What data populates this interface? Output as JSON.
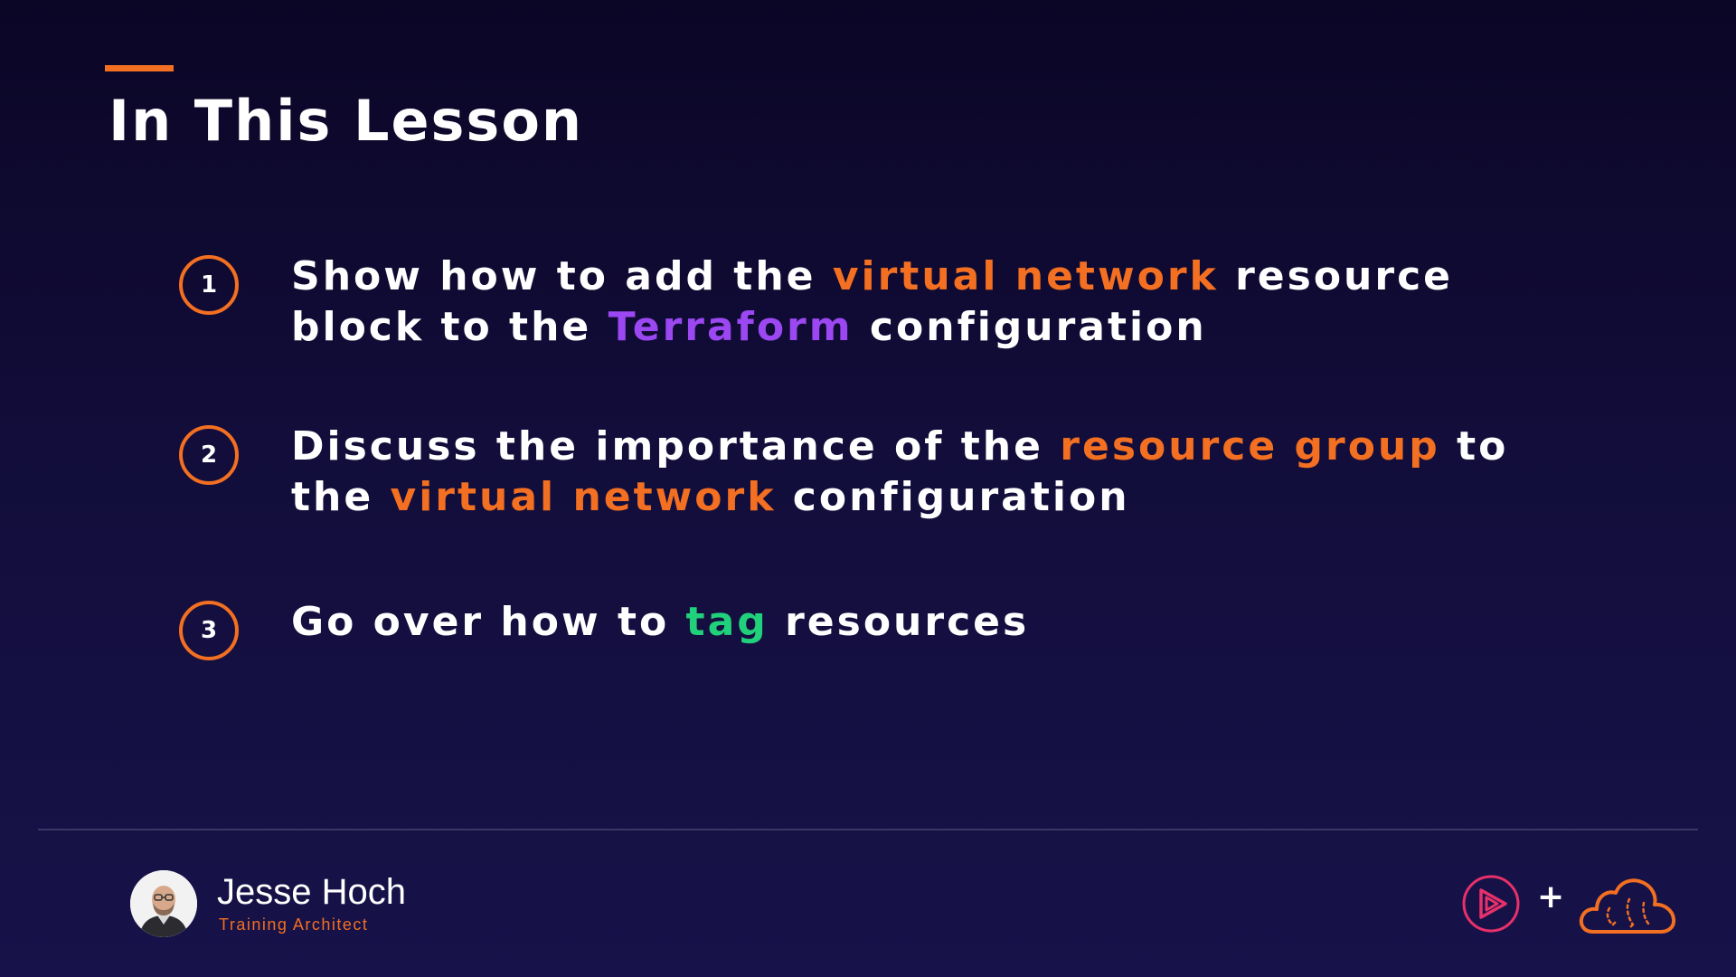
{
  "slide": {
    "title": "In This Lesson",
    "items": [
      {
        "number": "1",
        "segments": [
          {
            "text": "Show how to add the ",
            "style": "plain"
          },
          {
            "text": "virtual network",
            "style": "orange"
          },
          {
            "text": " resource block to the ",
            "style": "plain"
          },
          {
            "text": "Terraform",
            "style": "purple"
          },
          {
            "text": " configuration",
            "style": "plain"
          }
        ]
      },
      {
        "number": "2",
        "segments": [
          {
            "text": "Discuss the importance of the ",
            "style": "plain"
          },
          {
            "text": "resource group",
            "style": "orange"
          },
          {
            "text": " to the ",
            "style": "plain"
          },
          {
            "text": "virtual network",
            "style": "orange"
          },
          {
            "text": " configuration",
            "style": "plain"
          }
        ]
      },
      {
        "number": "3",
        "segments": [
          {
            "text": "Go over how to ",
            "style": "plain"
          },
          {
            "text": "tag",
            "style": "green"
          },
          {
            "text": " resources",
            "style": "plain"
          }
        ]
      }
    ]
  },
  "presenter": {
    "name": "Jesse Hoch",
    "role": "Training Architect"
  },
  "footer": {
    "plus": "+",
    "icons": [
      "play-logo-icon",
      "cloud-logo-icon"
    ]
  },
  "colors": {
    "background_top": "#0b0626",
    "background_bottom": "#17134a",
    "accent_orange": "#f36f21",
    "highlight_purple": "#9b48f2",
    "highlight_green": "#21d07a",
    "play_logo": "#e8306a"
  }
}
